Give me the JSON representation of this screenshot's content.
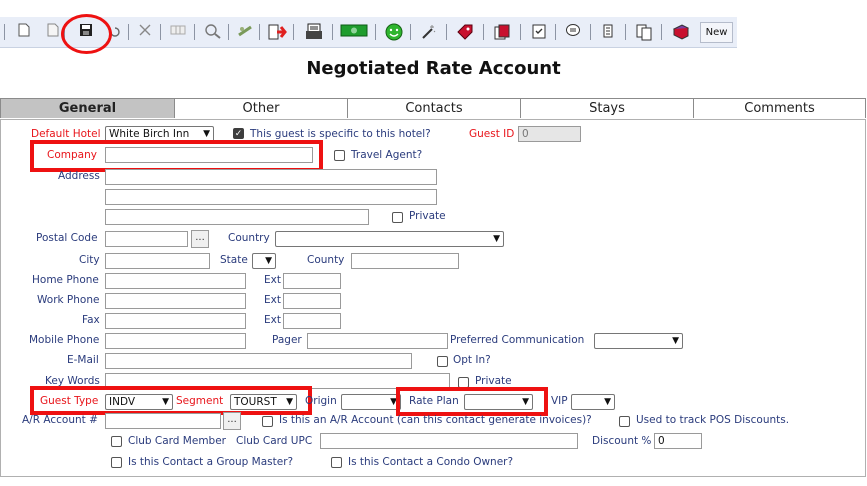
{
  "toolbar": {
    "new_label": "New",
    "icons": [
      "new-page-icon",
      "copy-page-icon",
      "save-icon",
      "undo-icon",
      "delete-icon",
      "grid-icon",
      "zoom-icon",
      "money-icon",
      "export-icon",
      "print-icon",
      "cash-icon",
      "smiley-icon",
      "magic-wand-icon",
      "tag-icon",
      "stack-icon",
      "checklist-icon",
      "speech-icon",
      "scroll-icon",
      "documents-icon",
      "book-icon"
    ]
  },
  "page_title": "Negotiated Rate Account",
  "tabs": [
    "General",
    "Other",
    "Contacts",
    "Stays",
    "Comments"
  ],
  "form": {
    "default_hotel_label": "Default Hotel",
    "default_hotel_value": "White Birch Inn",
    "specific_hotel_label": "This guest is specific to this hotel?",
    "guest_id_label": "Guest ID",
    "guest_id_value": "0",
    "company_label": "Company",
    "travel_agent_label": "Travel Agent?",
    "address_label": "Address",
    "private_label": "Private",
    "postal_code_label": "Postal Code",
    "lookup_label": "...",
    "country_label": "Country",
    "city_label": "City",
    "state_label": "State",
    "county_label": "County",
    "home_phone_label": "Home Phone",
    "work_phone_label": "Work Phone",
    "fax_label": "Fax",
    "mobile_phone_label": "Mobile Phone",
    "ext_label": "Ext",
    "pager_label": "Pager",
    "preferred_comm_label": "Preferred Communication",
    "email_label": "E-Mail",
    "opt_in_label": "Opt In?",
    "key_words_label": "Key Words",
    "guest_type_label": "Guest Type",
    "guest_type_value": "INDV",
    "segment_label": "Segment",
    "segment_value": "TOURST",
    "origin_label": "Origin",
    "rate_plan_label": "Rate Plan",
    "vip_label": "VIP",
    "ar_account_label": "A/R Account #",
    "ar_question_label": "Is this an A/R Account (can this contact generate invoices)?",
    "pos_discount_label": "Used to track POS Discounts.",
    "club_card_member_label": "Club Card Member",
    "club_card_upc_label": "Club Card UPC",
    "discount_label": "Discount %",
    "discount_value": "0",
    "group_master_label": "Is this Contact a Group Master?",
    "condo_owner_label": "Is this Contact a Condo Owner?"
  },
  "colors": {
    "required_label": "#e8141a",
    "label": "#2a3b7c",
    "highlight": "#ee1111",
    "active_tab": "#c3c3c3"
  }
}
